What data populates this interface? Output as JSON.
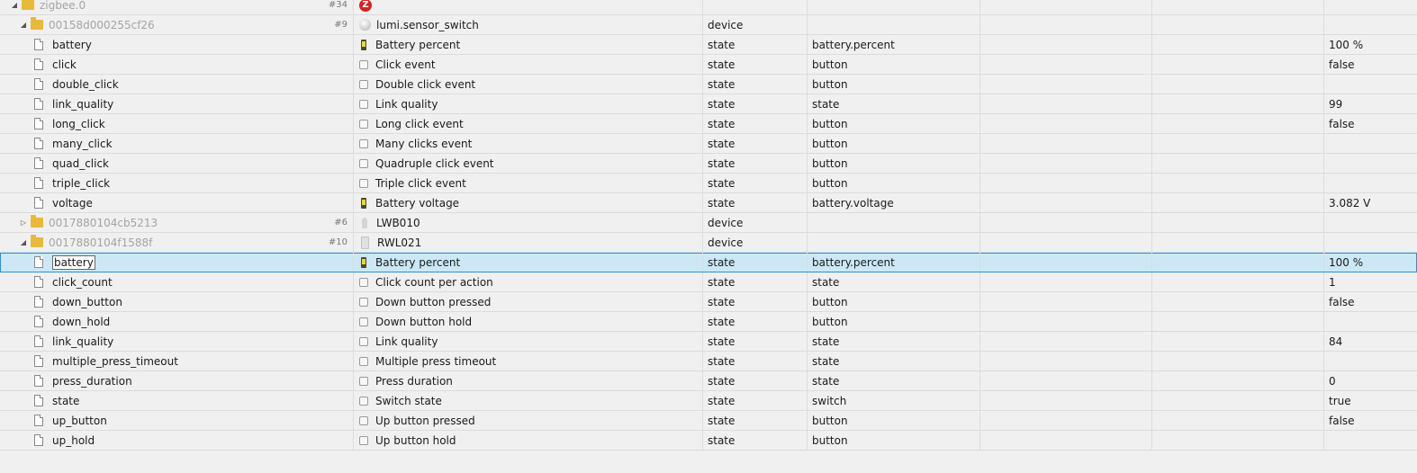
{
  "rows": [
    {
      "level": 0,
      "kind": "folder",
      "toggle": "open",
      "name": "zigbee.0",
      "count": "#34",
      "icon": "zigbee-icon",
      "icon_glyph": "Z",
      "title": "",
      "type": "",
      "role": "",
      "value": "",
      "muted": true
    },
    {
      "level": 1,
      "kind": "folder",
      "toggle": "open",
      "name": "00158d000255cf26",
      "count": "#9",
      "icon": "sphere-icon",
      "title": "lumi.sensor_switch",
      "type": "device",
      "role": "",
      "value": "",
      "muted": true
    },
    {
      "level": 2,
      "kind": "state",
      "name": "battery",
      "icon": "battery-icon",
      "title": "Battery percent",
      "type": "state",
      "role": "battery.percent",
      "value": "100 %"
    },
    {
      "level": 2,
      "kind": "state",
      "name": "click",
      "icon": "state-icon",
      "title": "Click event",
      "type": "state",
      "role": "button",
      "value": "false"
    },
    {
      "level": 2,
      "kind": "state",
      "name": "double_click",
      "icon": "state-icon",
      "title": "Double click event",
      "type": "state",
      "role": "button",
      "value": ""
    },
    {
      "level": 2,
      "kind": "state",
      "name": "link_quality",
      "icon": "state-icon",
      "title": "Link quality",
      "type": "state",
      "role": "state",
      "value": "99"
    },
    {
      "level": 2,
      "kind": "state",
      "name": "long_click",
      "icon": "state-icon",
      "title": "Long click event",
      "type": "state",
      "role": "button",
      "value": "false"
    },
    {
      "level": 2,
      "kind": "state",
      "name": "many_click",
      "icon": "state-icon",
      "title": "Many clicks event",
      "type": "state",
      "role": "button",
      "value": ""
    },
    {
      "level": 2,
      "kind": "state",
      "name": "quad_click",
      "icon": "state-icon",
      "title": "Quadruple click event",
      "type": "state",
      "role": "button",
      "value": ""
    },
    {
      "level": 2,
      "kind": "state",
      "name": "triple_click",
      "icon": "state-icon",
      "title": "Triple click event",
      "type": "state",
      "role": "button",
      "value": ""
    },
    {
      "level": 2,
      "kind": "state",
      "name": "voltage",
      "icon": "battery-icon",
      "title": "Battery voltage",
      "type": "state",
      "role": "battery.voltage",
      "value": "3.082 V"
    },
    {
      "level": 1,
      "kind": "folder",
      "toggle": "closed",
      "name": "0017880104cb5213",
      "count": "#6",
      "icon": "bulb-icon",
      "title": "LWB010",
      "type": "device",
      "role": "",
      "value": "",
      "muted": true
    },
    {
      "level": 1,
      "kind": "folder",
      "toggle": "open",
      "name": "0017880104f1588f",
      "count": "#10",
      "icon": "remote-icon",
      "title": "RWL021",
      "type": "device",
      "role": "",
      "value": "",
      "muted": true
    },
    {
      "level": 2,
      "kind": "state",
      "name": "battery",
      "icon": "battery-icon",
      "title": "Battery percent",
      "type": "state",
      "role": "battery.percent",
      "value": "100 %",
      "selected": true
    },
    {
      "level": 2,
      "kind": "state",
      "name": "click_count",
      "icon": "state-icon",
      "title": "Click count per action",
      "type": "state",
      "role": "state",
      "value": "1"
    },
    {
      "level": 2,
      "kind": "state",
      "name": "down_button",
      "icon": "state-icon",
      "title": "Down button pressed",
      "type": "state",
      "role": "button",
      "value": "false"
    },
    {
      "level": 2,
      "kind": "state",
      "name": "down_hold",
      "icon": "state-icon",
      "title": "Down button hold",
      "type": "state",
      "role": "button",
      "value": ""
    },
    {
      "level": 2,
      "kind": "state",
      "name": "link_quality",
      "icon": "state-icon",
      "title": "Link quality",
      "type": "state",
      "role": "state",
      "value": "84"
    },
    {
      "level": 2,
      "kind": "state",
      "name": "multiple_press_timeout",
      "icon": "state-icon",
      "title": "Multiple press timeout",
      "type": "state",
      "role": "state",
      "value": ""
    },
    {
      "level": 2,
      "kind": "state",
      "name": "press_duration",
      "icon": "state-icon",
      "title": "Press duration",
      "type": "state",
      "role": "state",
      "value": "0"
    },
    {
      "level": 2,
      "kind": "state",
      "name": "state",
      "icon": "state-icon",
      "title": "Switch state",
      "type": "state",
      "role": "switch",
      "value": "true"
    },
    {
      "level": 2,
      "kind": "state",
      "name": "up_button",
      "icon": "state-icon",
      "title": "Up button pressed",
      "type": "state",
      "role": "button",
      "value": "false"
    },
    {
      "level": 2,
      "kind": "state",
      "name": "up_hold",
      "icon": "state-icon",
      "title": "Up button hold",
      "type": "state",
      "role": "button",
      "value": ""
    }
  ]
}
